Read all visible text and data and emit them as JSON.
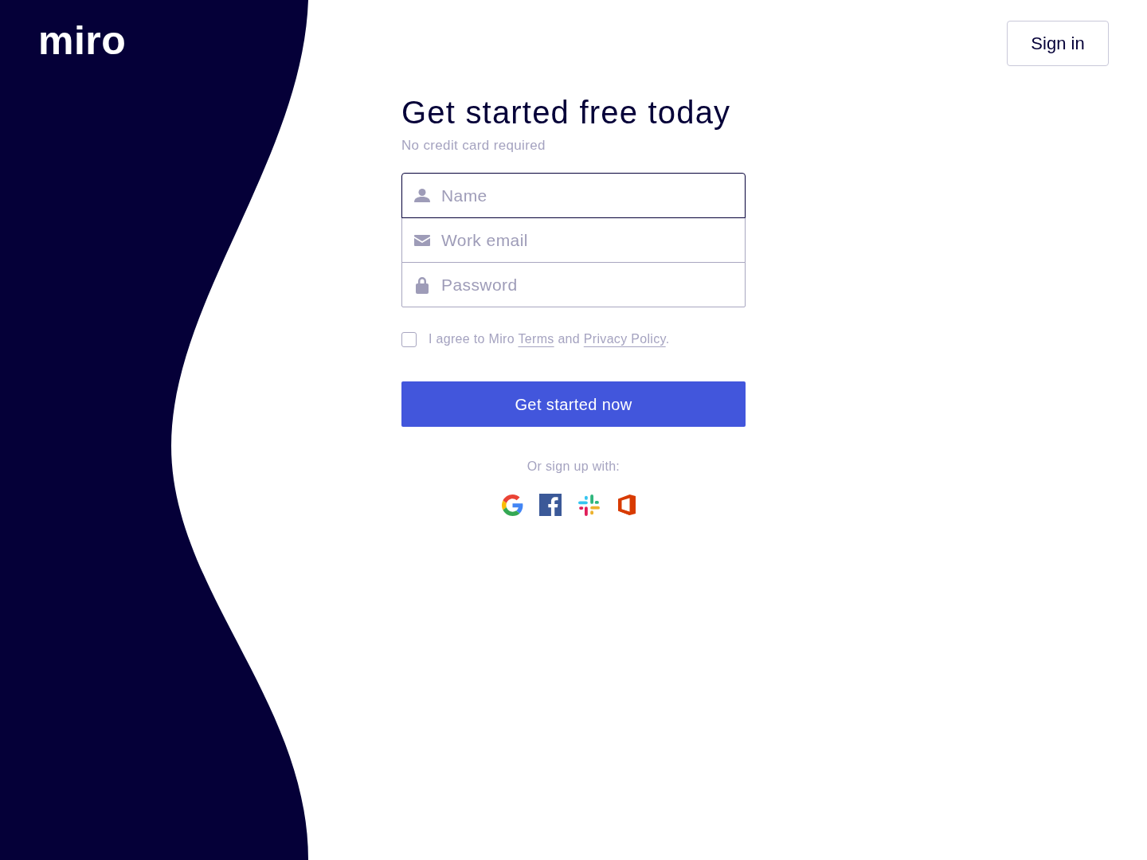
{
  "logo": {
    "text": "miro"
  },
  "header": {
    "sign_in": "Sign in"
  },
  "form": {
    "title": "Get started free today",
    "subtitle": "No credit card required",
    "fields": [
      {
        "kind": "name",
        "placeholder": "Name",
        "focused": true
      },
      {
        "kind": "email",
        "placeholder": "Work email",
        "focused": false
      },
      {
        "kind": "password",
        "placeholder": "Password",
        "focused": false
      }
    ],
    "agreement": {
      "checked": false,
      "parts": [
        {
          "kind": "text",
          "text": "I agree to Miro"
        },
        {
          "kind": "link",
          "text": "Terms"
        },
        {
          "kind": "text",
          "text": "and"
        },
        {
          "kind": "link",
          "text": "Privacy Policy"
        },
        {
          "kind": "punctuation",
          "text": "."
        }
      ]
    },
    "submit": "Get started now",
    "social_prompt": "Or sign up with:",
    "social_buttons": [
      {
        "kind": "google"
      },
      {
        "kind": "facebook"
      },
      {
        "kind": "slack"
      },
      {
        "kind": "office"
      }
    ]
  }
}
